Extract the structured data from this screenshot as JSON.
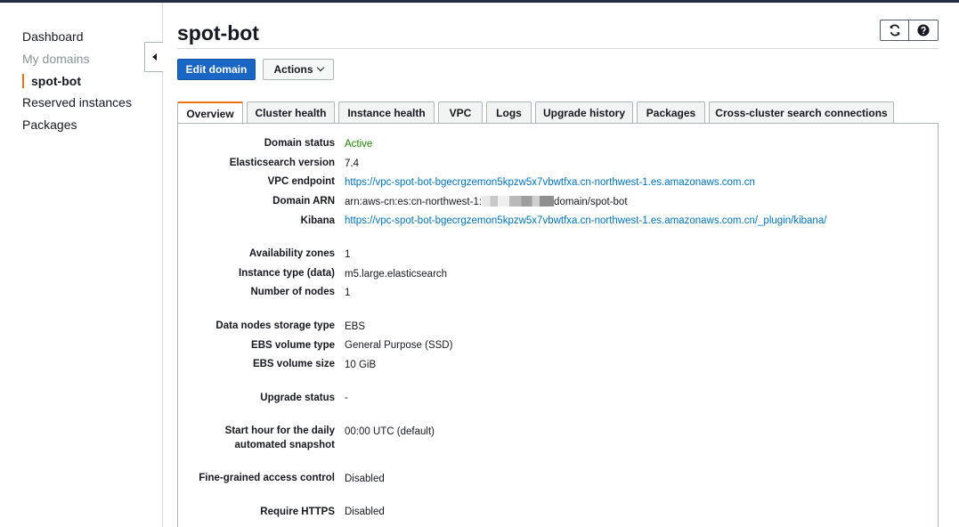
{
  "sidebar": {
    "items": [
      {
        "label": "Dashboard"
      },
      {
        "label": "My domains"
      },
      {
        "label": "spot-bot"
      },
      {
        "label": "Reserved instances"
      },
      {
        "label": "Packages"
      }
    ]
  },
  "header": {
    "title": "spot-bot",
    "edit_label": "Edit domain",
    "actions_label": "Actions"
  },
  "tabs": [
    {
      "label": "Overview"
    },
    {
      "label": "Cluster health"
    },
    {
      "label": "Instance health"
    },
    {
      "label": "VPC"
    },
    {
      "label": "Logs"
    },
    {
      "label": "Upgrade history"
    },
    {
      "label": "Packages"
    },
    {
      "label": "Cross-cluster search connections"
    }
  ],
  "details": {
    "domain_status": {
      "label": "Domain status",
      "value": "Active"
    },
    "es_version": {
      "label": "Elasticsearch version",
      "value": "7.4"
    },
    "vpc_endpoint": {
      "label": "VPC endpoint",
      "value": "https://vpc-spot-bot-bgecrgzemon5kpzw5x7vbwtfxa.cn-northwest-1.es.amazonaws.com.cn"
    },
    "domain_arn": {
      "label": "Domain ARN",
      "prefix": "arn:aws-cn:es:cn-northwest-1:",
      "suffix": "domain/spot-bot"
    },
    "kibana": {
      "label": "Kibana",
      "value": "https://vpc-spot-bot-bgecrgzemon5kpzw5x7vbwtfxa.cn-northwest-1.es.amazonaws.com.cn/_plugin/kibana/"
    },
    "availability_zones": {
      "label": "Availability zones",
      "value": "1"
    },
    "instance_type": {
      "label": "Instance type (data)",
      "value": "m5.large.elasticsearch"
    },
    "number_of_nodes": {
      "label": "Number of nodes",
      "value": "1"
    },
    "storage_type": {
      "label": "Data nodes storage type",
      "value": "EBS"
    },
    "ebs_volume_type": {
      "label": "EBS volume type",
      "value": "General Purpose (SSD)"
    },
    "ebs_volume_size": {
      "label": "EBS volume size",
      "value": "10 GiB"
    },
    "upgrade_status": {
      "label": "Upgrade status",
      "value": "-"
    },
    "snapshot_hour": {
      "label_line1": "Start hour for the daily",
      "label_line2": "automated snapshot",
      "value": "00:00 UTC (default)"
    },
    "fine_grained": {
      "label": "Fine-grained access control",
      "value": "Disabled"
    },
    "require_https": {
      "label": "Require HTTPS",
      "value": "Disabled"
    }
  },
  "colors": {
    "accent": "#ec7211",
    "primary": "#1a66c4",
    "link": "#0073bb",
    "status_ok": "#1d8102"
  },
  "icons": [
    "refresh-icon",
    "help-icon",
    "caret-left-icon",
    "chevron-down-icon"
  ]
}
